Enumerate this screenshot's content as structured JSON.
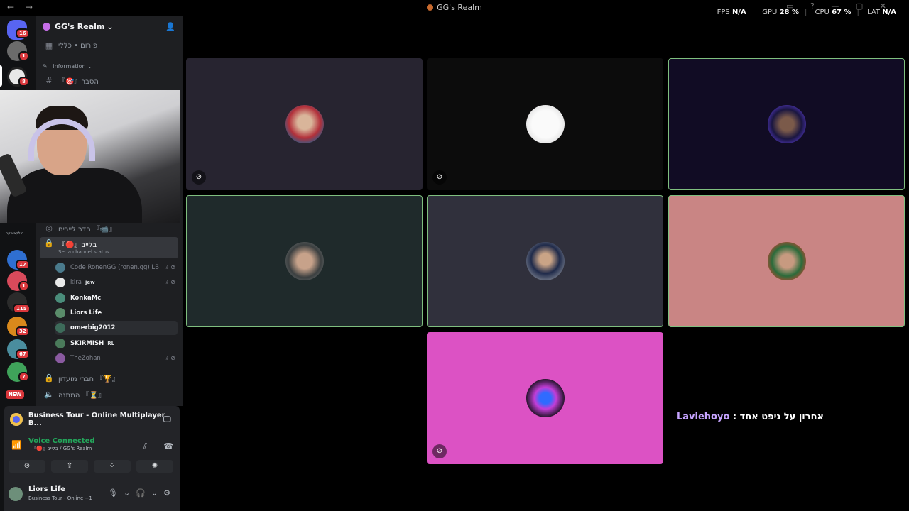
{
  "window": {
    "title": "GG's Realm",
    "nav": "← →"
  },
  "perf": {
    "fps_label": "FPS",
    "fps": "N/A",
    "gpu_label": "GPU",
    "gpu": "28 %",
    "cpu_label": "CPU",
    "cpu": "67 %",
    "lat_label": "LAT",
    "lat": "N/A"
  },
  "guilds": {
    "badges": [
      "16",
      "1",
      "8",
      "17",
      "1",
      "115",
      "32",
      "67",
      "7",
      "NEW"
    ],
    "folder_label": "הולקבוניקה"
  },
  "server": {
    "name": "GG's Realm"
  },
  "channels": {
    "forum": "פורום • כללי",
    "info_category": "information",
    "explain": "『🎯』הסבר",
    "live_room": "חדר לייבים 『📹』",
    "active_channel": "『🔴』בלייב",
    "channel_status": "Set a channel status",
    "club": "חברי מועדון 『🏆』",
    "waiting": "המתנה 『⏳』"
  },
  "members": [
    {
      "name": "Code RonenGG (ronen.gg) LB",
      "tag": "",
      "bright": false
    },
    {
      "name": "kira",
      "tag": "jew",
      "bright": false
    },
    {
      "name": "KonkaMc",
      "tag": "",
      "bright": true
    },
    {
      "name": "Liors Life",
      "tag": "",
      "bright": true
    },
    {
      "name": "omerbig2012",
      "tag": "",
      "bright": true
    },
    {
      "name": "SKIRMISH",
      "tag": "RL",
      "bright": true
    },
    {
      "name": "TheZohan",
      "tag": "",
      "bright": false
    }
  ],
  "activity": {
    "game": "Business Tour - Online Multiplayer B..."
  },
  "voice": {
    "status": "Voice Connected",
    "location": "『🔴』בלייב / GG's Realm"
  },
  "user": {
    "name": "Liors Life",
    "status": "Business Tour - Online +1"
  },
  "caption": {
    "who": "Laviehoyo",
    "separator": " : ",
    "msg": "אחרון על גיפט אחד"
  },
  "colors": {
    "speaking_border": "#7fbf7f",
    "voice_green": "#23a55a",
    "badge_red": "#da373c"
  }
}
